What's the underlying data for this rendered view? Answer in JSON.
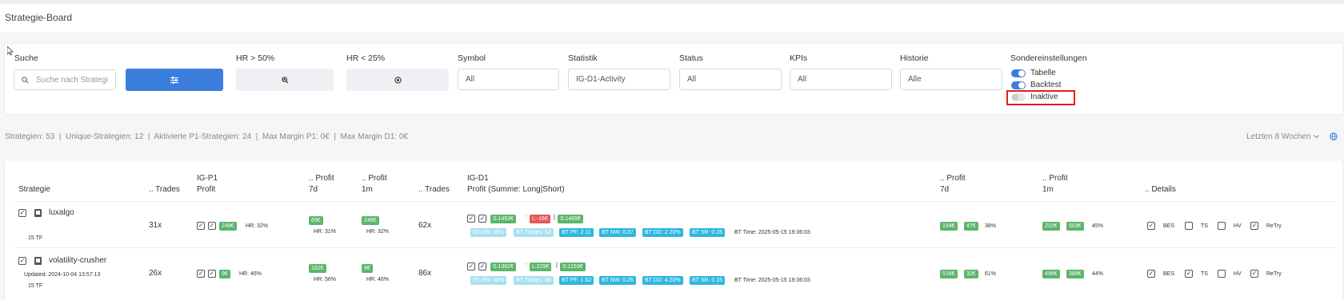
{
  "header": {
    "title": "Strategie-Board"
  },
  "filters": {
    "search_label": "Suche",
    "search_placeholder": "Suche nach Strategie",
    "hr50_label": "HR > 50%",
    "hr25_label": "HR < 25%",
    "symbol_label": "Symbol",
    "symbol_value": "All",
    "statistik_label": "Statistik",
    "statistik_value": "IG-D1-Activity",
    "status_label": "Status",
    "status_value": "All",
    "kpis_label": "KPIs",
    "kpis_value": "All",
    "historie_label": "Historie",
    "historie_value": "Alle",
    "sonder_label": "Sondereinstellungen",
    "toggles": [
      {
        "label": "Tabelle",
        "on": true
      },
      {
        "label": "Backtest",
        "on": true
      },
      {
        "label": "Inaktive",
        "on": false
      }
    ],
    "highlight_color": "#e0201c"
  },
  "stats": {
    "text": "Strategien: 53  |  Unique-Strategien: 12  |  Aktivierte P1-Strategien: 24  |  Max Margin P1: 0€  |  Max Margin D1: 0€",
    "period": "Letzten 8 Wochen"
  },
  "table": {
    "headers": {
      "strategie": "Strategie",
      "trades1": ".. Trades",
      "igp1_top": "IG-P1",
      "igp1_bottom": "Profit",
      "profit7_top": ".. Profit",
      "profit7_bottom": "7d",
      "profit1m_top": ".. Profit",
      "profit1m_bottom": "1m",
      "trades2": ".. Trades",
      "igd1_top": "IG-D1",
      "igd1_bottom": "Profit (Summe: Long|Short)",
      "profit7b_top": ".. Profit",
      "profit7b_bottom": "7d",
      "profit1mb_top": ".. Profit",
      "profit1mb_bottom": "1m",
      "details": ".. Details"
    },
    "rows": [
      {
        "name": "luxalgo",
        "updated": "",
        "tf": "15 TF",
        "trades": "31x",
        "p1_profit": "248€",
        "p1_hr": "HR: 32%",
        "p7": "69€",
        "p7_hr": "HR: 31%",
        "p1m": "248€",
        "p1m_hr": "HR: 32%",
        "trades2": "62x",
        "d1_sum": "S:1453€",
        "d1_long": "L:-16€",
        "d1_short": "S:1469€",
        "bt_hr": "BT HR: 48%",
        "bt_trades": "BT Trades: 62",
        "bt_pf": "BT PF: 2.11",
        "bt_nw": "BT NW: 0.37",
        "bt_dd": "BT DD: 2.20%",
        "bt_sr": "BT SR: 0.26",
        "bt_time": "BT Time: 2025-05-15 19:36:03",
        "p7b_a": "194€",
        "p7b_b": "47€",
        "p7b_pct": "38%",
        "p1mb_a": "210€",
        "p1mb_b": "503€",
        "p1mb_pct": "45%",
        "bes": "BES",
        "ts": "TS",
        "hv": "HV",
        "retry": "ReTry"
      },
      {
        "name": "volatility-crusher",
        "updated": "Updated: 2024-10-04 13:57:13",
        "tf": "15 TF",
        "trades": "26x",
        "p1_profit": "9€",
        "p1_hr": "HR: 46%",
        "p7": "182€",
        "p7_hr": "HR: 56%",
        "p1m": "9€",
        "p1m_hr": "HR: 46%",
        "trades2": "86x",
        "d1_sum": "S:1382€",
        "d1_long": "L:229€",
        "d1_short": "S:1153€",
        "bt_hr": "BT HR: 40%",
        "bt_trades": "BT Trades: 86",
        "bt_pf": "BT PF: 1.62",
        "bt_nw": "BT NW: 0.26",
        "bt_dd": "BT DD: 4.20%",
        "bt_sr": "BT SR: 0.15",
        "bt_time": "BT Time: 2025-05-15 19:36:03",
        "p7b_a": "516€",
        "p7b_b": "32€",
        "p7b_pct": "61%",
        "p1mb_a": "496€",
        "p1mb_b": "388€",
        "p1mb_pct": "44%",
        "bes": "BES",
        "ts": "TS",
        "hv": "HV",
        "retry": "ReTry"
      }
    ]
  },
  "colors": {
    "accent": "#3b7ddd",
    "positive": "#5cb56a",
    "negative": "#e2585a",
    "bt": "#2eb6e1"
  }
}
